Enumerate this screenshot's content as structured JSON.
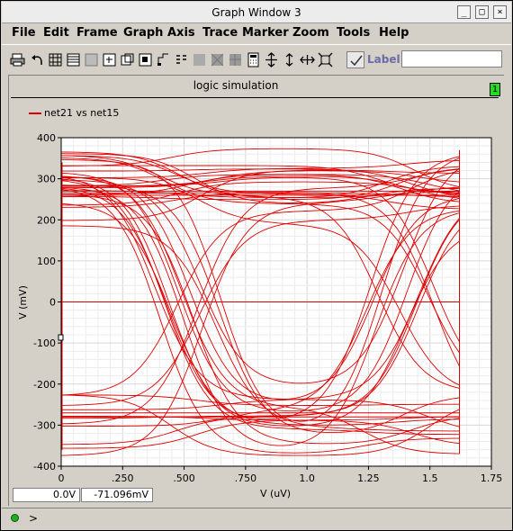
{
  "window": {
    "title": "Graph Window 3",
    "min_icon": "minimize-icon",
    "max_icon": "maximize-icon",
    "close_icon": "close-icon"
  },
  "menu": [
    "File",
    "Edit",
    "Frame",
    "Graph",
    "Axis",
    "Trace",
    "Marker",
    "Zoom",
    "Tools",
    "Help"
  ],
  "toolbar": {
    "icons": [
      "print-icon",
      "undo-icon",
      "grid-icon",
      "table-icon",
      "table2-icon",
      "zoom-fit-icon",
      "zoom-box-icon",
      "zoom-area-icon",
      "marker-icon",
      "strip-icon",
      "disabled-icon-1",
      "disabled-icon-2",
      "disabled-icon-3",
      "calculator-icon",
      "resize-vertical-icon",
      "resize-horizontal-icon",
      "fit-all-icon"
    ],
    "label_text": "Label",
    "label_value": ""
  },
  "graph": {
    "title": "logic simulation",
    "pane_badge": "1",
    "legend": {
      "name": "net21 vs net15",
      "color": "#dd0000"
    }
  },
  "chart_data": {
    "type": "line",
    "title": "logic simulation",
    "xlabel": "V (uV)",
    "ylabel": "V (mV)",
    "xlim": [
      0,
      1.75
    ],
    "ylim": [
      -400,
      400
    ],
    "x_ticks": [
      "0",
      ".250",
      ".500",
      ".750",
      "1.0",
      "1.25",
      "1.5",
      "1.75"
    ],
    "y_ticks": [
      "400",
      "300",
      "200",
      "100",
      "0",
      "-100",
      "-200",
      "-300",
      "-400"
    ],
    "grid": true,
    "legend_position": "top-left",
    "series": [
      {
        "name": "net21 vs net15",
        "color": "#dd0000",
        "style": "eye-diagram"
      }
    ]
  },
  "readouts": {
    "x": "0.0V",
    "y": "-71.096mV"
  },
  "status": {
    "prompt": ">"
  }
}
